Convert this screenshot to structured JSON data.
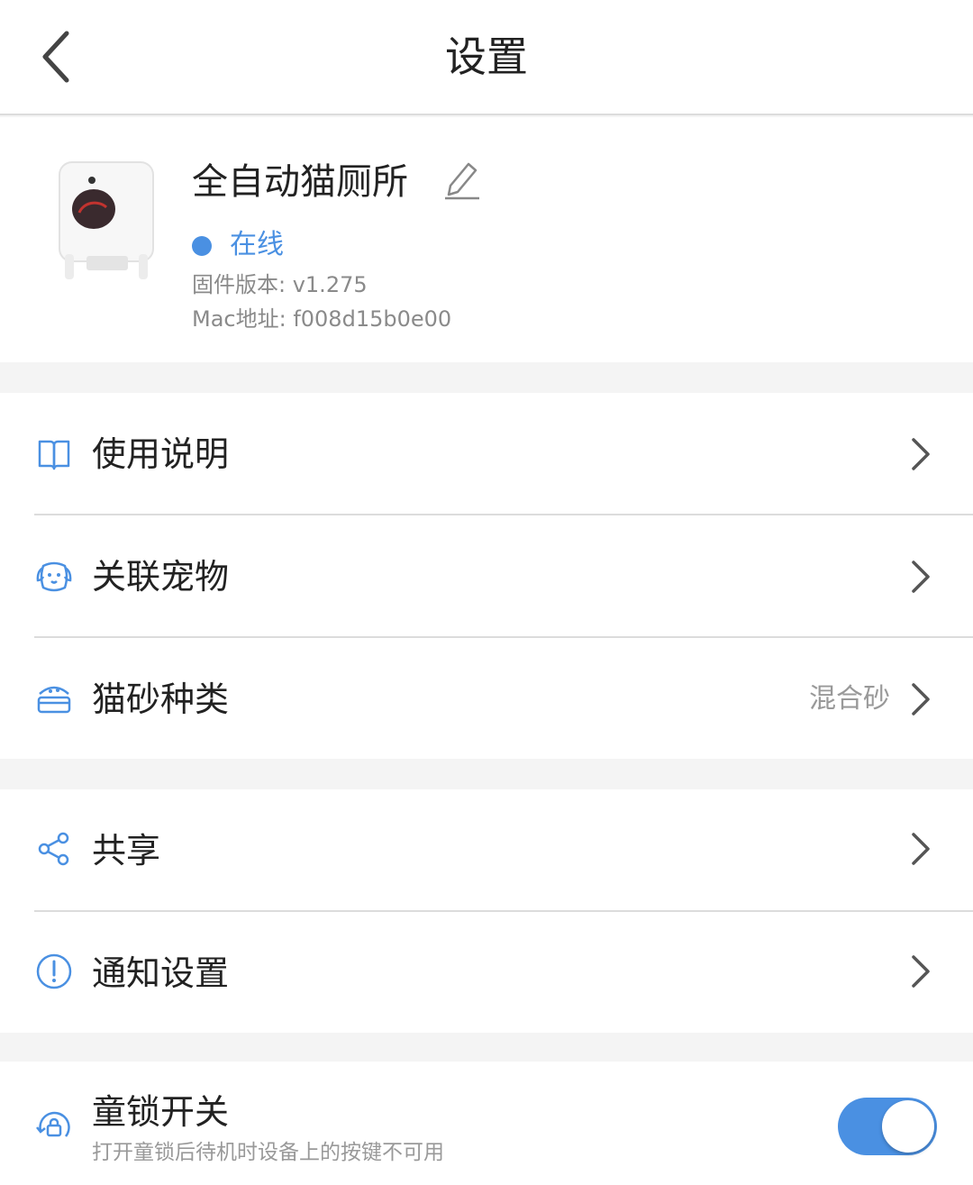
{
  "header": {
    "title": "设置"
  },
  "device": {
    "name": "全自动猫厕所",
    "status": "在线",
    "firmware": "固件版本: v1.275",
    "mac": "Mac地址: f008d15b0e00"
  },
  "menu": [
    {
      "label": "使用说明",
      "icon": "book-icon"
    },
    {
      "label": "关联宠物",
      "icon": "pet-face-icon"
    },
    {
      "label": "猫砂种类",
      "icon": "litter-box-icon",
      "value": "混合砂"
    },
    {
      "label": "共享",
      "icon": "share-icon"
    },
    {
      "label": "通知设置",
      "icon": "alert-circle-icon"
    }
  ],
  "child_lock": {
    "label": "童锁开关",
    "description": "打开童锁后待机时设备上的按键不可用",
    "enabled": true
  },
  "colors": {
    "accent": "#4a90e2",
    "background": "#f4f4f4"
  }
}
